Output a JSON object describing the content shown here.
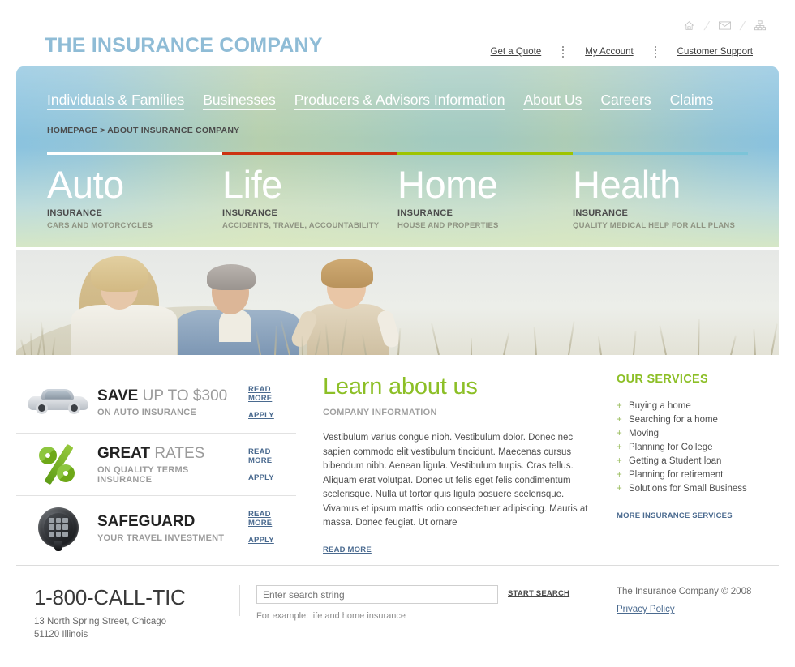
{
  "header": {
    "logo": "THE INSURANCE COMPANY",
    "icons": [
      {
        "name": "home-icon",
        "glyph": "⌂"
      },
      {
        "name": "mail-icon",
        "glyph": "✉"
      },
      {
        "name": "sitemap-icon",
        "glyph": "⛓"
      }
    ],
    "links": [
      {
        "label": "Get a Quote"
      },
      {
        "label": "My Account"
      },
      {
        "label": "Customer Support"
      }
    ]
  },
  "nav": {
    "items": [
      {
        "label": "Individuals & Families"
      },
      {
        "label": "Businesses"
      },
      {
        "label": "Producers & Advisors Information"
      },
      {
        "label": "About Us"
      },
      {
        "label": "Careers"
      },
      {
        "label": "Claims"
      }
    ],
    "breadcrumb": "HOMEPAGE > ABOUT INSURANCE COMPANY"
  },
  "categories": [
    {
      "title": "Auto",
      "sub1": "INSURANCE",
      "sub2": "CARS AND MOTORCYCLES",
      "bar_color": "#ffffff"
    },
    {
      "title": "Life",
      "sub1": "INSURANCE",
      "sub2": "ACCIDENTS, TRAVEL, ACCOUNTABILITY",
      "bar_color": "#cc3311"
    },
    {
      "title": "Home",
      "sub1": "INSURANCE",
      "sub2": "HOUSE AND PROPERTIES",
      "bar_color": "#9ec400"
    },
    {
      "title": "Health",
      "sub1": "INSURANCE",
      "sub2": "QUALITY MEDICAL HELP FOR ALL PLANS",
      "bar_color": "#7cc4d8"
    }
  ],
  "promos": {
    "read_more_label": "READ MORE",
    "apply_label": "APPLY",
    "items": [
      {
        "icon": "car-icon",
        "strong": "SAVE",
        "rest": " UP TO $300",
        "sub": "ON AUTO INSURANCE"
      },
      {
        "icon": "percent-icon",
        "strong": "GREAT",
        "rest": " RATES",
        "sub": "ON QUALITY TERMS INSURANCE"
      },
      {
        "icon": "safe-icon",
        "strong": "SAFEGUARD",
        "rest": "",
        "sub": "YOUR TRAVEL INVESTMENT"
      }
    ]
  },
  "main": {
    "heading": "Learn about us",
    "subheading": "COMPANY INFORMATION",
    "body": "Vestibulum varius congue nibh. Vestibulum dolor. Donec nec sapien commodo elit vestibulum tincidunt. Maecenas cursus bibendum nibh. Aenean ligula. Vestibulum turpis. Cras tellus. Aliquam erat volutpat. Donec ut felis eget felis condimentum scelerisque. Nulla ut tortor quis ligula posuere scelerisque. Vivamus et ipsum mattis odio consectetuer adipiscing. Mauris at massa. Donec feugiat. Ut ornare",
    "read_more": "READ MORE"
  },
  "services": {
    "title": "OUR SERVICES",
    "bullet": "+",
    "items": [
      {
        "label": "Buying a home"
      },
      {
        "label": "Searching for a home"
      },
      {
        "label": "Moving"
      },
      {
        "label": "Planning for College"
      },
      {
        "label": "Getting a Student loan"
      },
      {
        "label": "Planning for retirement"
      },
      {
        "label": "Solutions for Small Business"
      }
    ],
    "more_label": "MORE INSURANCE SERVICES"
  },
  "footer": {
    "phone": "1-800-CALL-TIC",
    "address_line1": "13 North Spring Street, Chicago",
    "address_line2": "51120 Illinois",
    "search_placeholder": "Enter search string",
    "search_value": "",
    "search_button": "START SEARCH",
    "search_hint": "For example: life and home insurance",
    "copyright": "The Insurance Company © 2008",
    "privacy_label": "Privacy Policy"
  },
  "colors": {
    "brand_blue": "#8fbcd6",
    "accent_green": "#8cbf26",
    "link_blue": "#4a6a8f"
  }
}
